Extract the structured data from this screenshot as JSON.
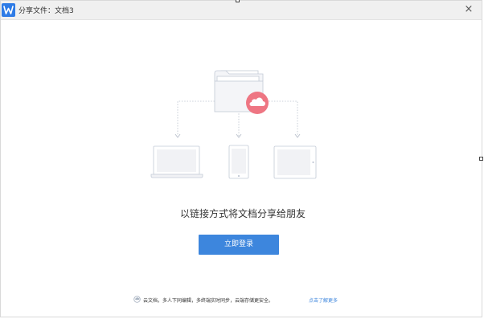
{
  "window": {
    "title": "分享文件：文档3",
    "close_glyph": "×",
    "logo_letter": "W",
    "logo_icon": "wps-logo-icon",
    "close_icon": "close-icon"
  },
  "illustration": {
    "folder_icon": "folder-icon",
    "cloud_icon": "cloud-icon",
    "laptop_icon": "laptop-icon",
    "phone_icon": "phone-icon",
    "tablet_icon": "tablet-icon",
    "accent_color": "#ee7683"
  },
  "main": {
    "tagline": "以链接方式将文档分享给朋友",
    "login_label": "立即登录",
    "login_color": "#3d86dd"
  },
  "footer": {
    "note": "云文档，多人下同编辑，多终端实时同步，云端存储更安全。",
    "link": "点击了解更多",
    "info_icon": "info-icon"
  }
}
